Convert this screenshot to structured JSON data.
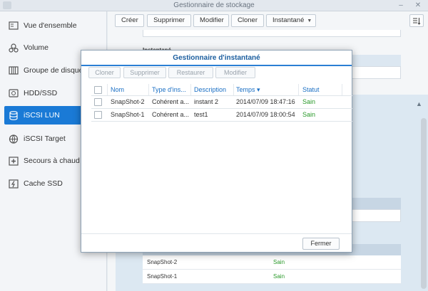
{
  "window": {
    "title": "Gestionnaire de stockage"
  },
  "sidebar": {
    "items": [
      {
        "label": "Vue d'ensemble",
        "icon": "overview-icon",
        "active": false
      },
      {
        "label": "Volume",
        "icon": "volume-icon",
        "active": false
      },
      {
        "label": "Groupe de disques",
        "icon": "disk-group-icon",
        "active": false
      },
      {
        "label": "HDD/SSD",
        "icon": "hdd-icon",
        "active": false
      },
      {
        "label": "iSCSI LUN",
        "icon": "database-icon",
        "active": true
      },
      {
        "label": "iSCSI Target",
        "icon": "globe-icon",
        "active": false
      },
      {
        "label": "Secours à chaud",
        "icon": "plus-box-icon",
        "active": false
      },
      {
        "label": "Cache SSD",
        "icon": "lightning-icon",
        "active": false
      }
    ]
  },
  "toolbar": {
    "create": "Créer",
    "delete": "Supprimer",
    "modify": "Modifier",
    "clone": "Cloner",
    "snapshot": "Instantané"
  },
  "background": {
    "section_label": "Instantané",
    "rows": [
      {
        "name": "SnapShot-2",
        "status": "Sain"
      },
      {
        "name": "SnapShot-1",
        "status": "Sain"
      }
    ]
  },
  "dialog": {
    "title": "Gestionnaire d'instantané",
    "toolbar": {
      "clone": "Cloner",
      "delete": "Supprimer",
      "restore": "Restaurer",
      "modify": "Modifier"
    },
    "columns": {
      "name": "Nom",
      "type": "Type d'ins...",
      "description": "Description",
      "time": "Temps ▾",
      "status": "Statut"
    },
    "rows": [
      {
        "name": "SnapShot-2",
        "type": "Cohérent a...",
        "description": "instant 2",
        "time": "2014/07/09 18:47:16",
        "status": "Sain"
      },
      {
        "name": "SnapShot-1",
        "type": "Cohérent a...",
        "description": "test1",
        "time": "2014/07/09 18:00:54",
        "status": "Sain"
      }
    ],
    "close": "Fermer"
  },
  "colors": {
    "accent": "#1a7ad6",
    "ok": "#2a9a2a",
    "header_text": "#1a6fc4"
  }
}
